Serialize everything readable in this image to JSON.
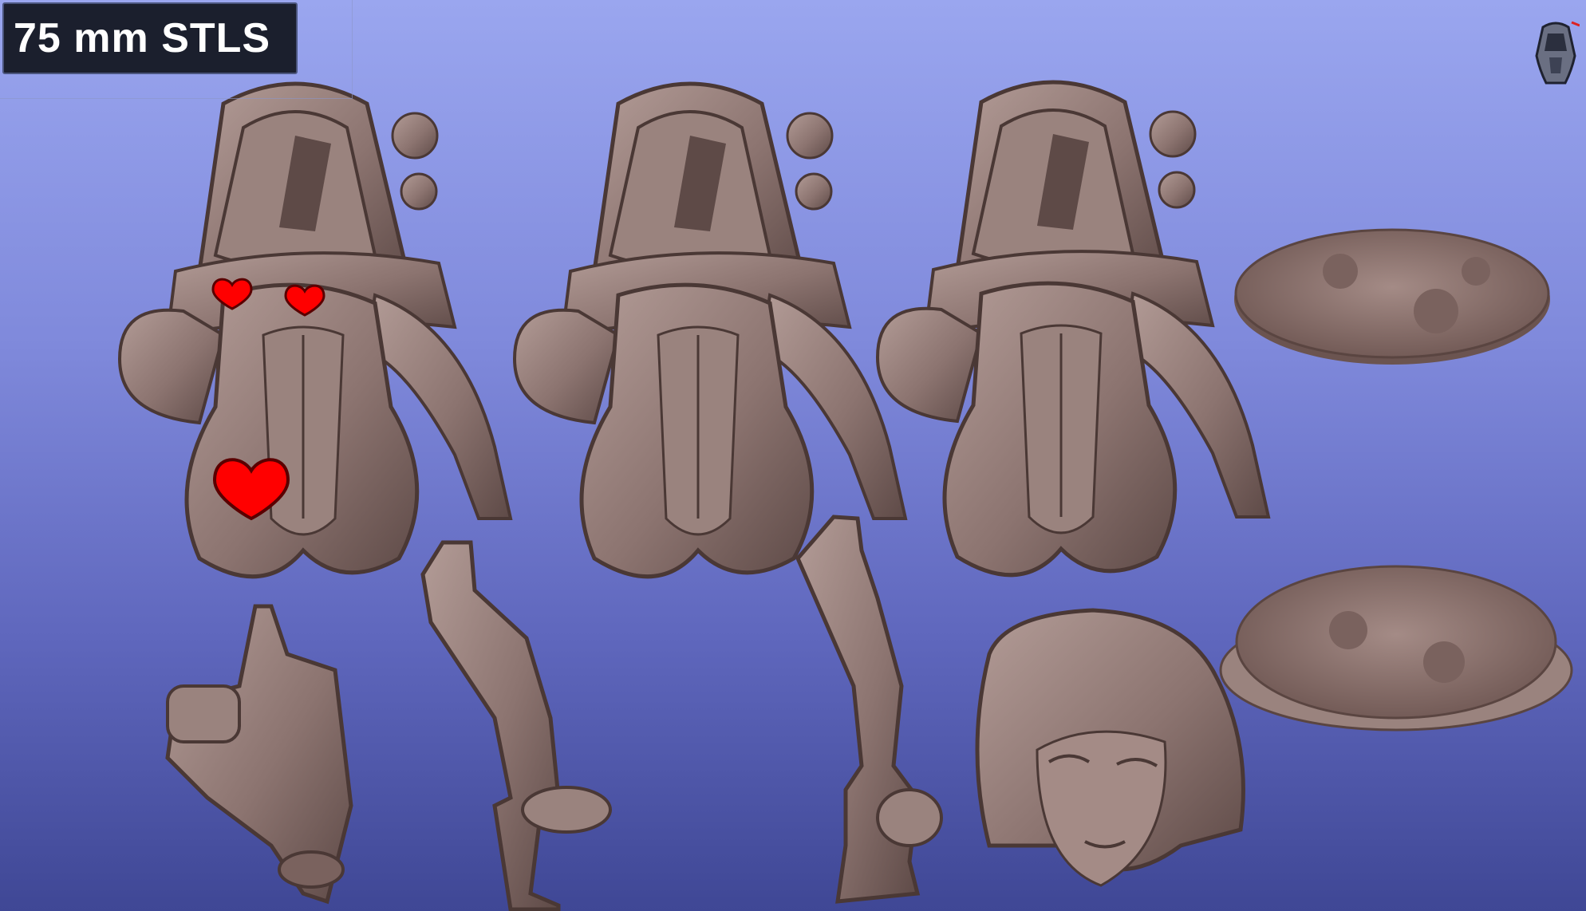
{
  "badge": {
    "label": "75 mm STLS"
  },
  "colors": {
    "model": "#8c7470",
    "model_shadow": "#5e4a47",
    "model_light": "#b39c97",
    "heart": "#ff0000"
  },
  "icons": {
    "view_orientation": "head-orientation-icon"
  },
  "models": [
    {
      "name": "body-censored"
    },
    {
      "name": "body-variant-a"
    },
    {
      "name": "body-variant-b"
    },
    {
      "name": "scenic-base-top"
    },
    {
      "name": "scenic-base-angled"
    },
    {
      "name": "arm-with-weapon"
    },
    {
      "name": "leg-left"
    },
    {
      "name": "leg-right"
    },
    {
      "name": "head"
    }
  ]
}
